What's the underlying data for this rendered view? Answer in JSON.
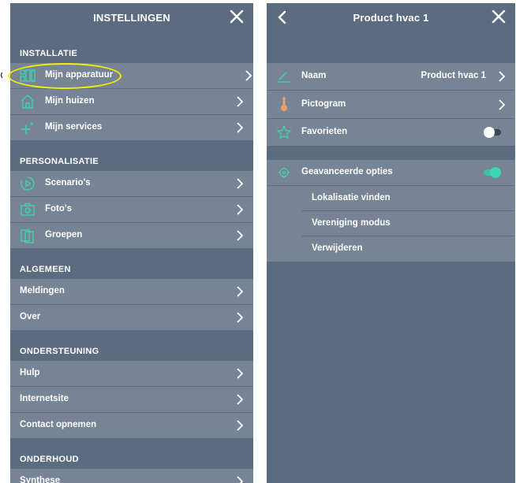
{
  "colors": {
    "panel": "#5c6c80",
    "row": "#778496",
    "accent": "#3fd6b2",
    "thermo": "#e9a06e",
    "highlight": "#f0f000"
  },
  "left": {
    "title": "INSTELLINGEN",
    "sections": {
      "installatie": "INSTALLATIE",
      "personalisatie": "PERSONALISATIE",
      "algemeen": "ALGEMEEN",
      "ondersteuning": "ONDERSTEUNING",
      "onderhoud": "ONDERHOUD"
    },
    "items": {
      "apparatuur": {
        "label": "Mijn apparatuur",
        "icon": "devices-grid-icon"
      },
      "huizen": {
        "label": "Mijn huizen",
        "icon": "house-icon"
      },
      "services": {
        "label": "Mijn services",
        "icon": "plus-sparkle-icon"
      },
      "scenarios": {
        "label": "Scenario's",
        "icon": "play-circle-icon"
      },
      "fotos": {
        "label": "Foto's",
        "icon": "camera-icon"
      },
      "groepen": {
        "label": "Groepen",
        "icon": "group-icon"
      },
      "meldingen": {
        "label": "Meldingen"
      },
      "over": {
        "label": "Over"
      },
      "hulp": {
        "label": "Hulp"
      },
      "internetsite": {
        "label": "Internetsite"
      },
      "contact": {
        "label": "Contact opnemen"
      },
      "synthese": {
        "label": "Synthese"
      }
    }
  },
  "right": {
    "title": "Product hvac 1",
    "naam": {
      "label": "Naam",
      "value": "Product hvac 1",
      "icon": "pencil-icon"
    },
    "pictogram": {
      "label": "Pictogram",
      "icon": "thermometer-icon"
    },
    "favorieten": {
      "label": "Favorieten",
      "icon": "star-icon",
      "on": false
    },
    "geavanceerd": {
      "label": "Geavanceerde opties",
      "icon": "gear-icon",
      "on": true
    },
    "sub": {
      "lokalisatie": "Lokalisatie vinden",
      "vereniging": "Vereniging modus",
      "verwijderen": "Verwijderen"
    }
  }
}
